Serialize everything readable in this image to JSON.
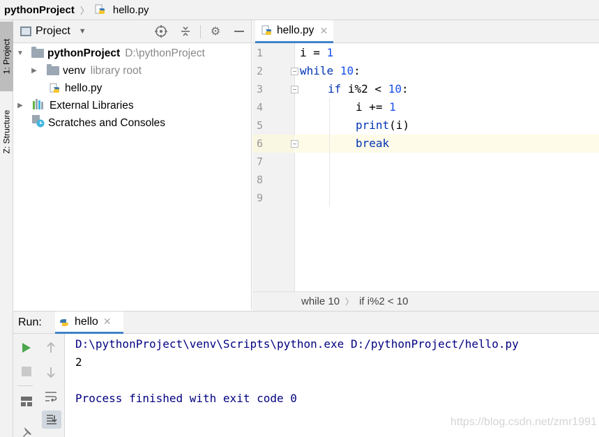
{
  "breadcrumb": {
    "project": "pythonProject",
    "file": "hello.py"
  },
  "side_tabs": {
    "project": "1: Project",
    "structure": "Z: Structure"
  },
  "project_panel": {
    "title": "Project",
    "tree": [
      {
        "name": "pythonProject",
        "note": "D:\\pythonProject"
      },
      {
        "name": "venv",
        "note": "library root"
      },
      {
        "name": "hello.py"
      },
      {
        "name": "External Libraries"
      },
      {
        "name": "Scratches and Consoles"
      }
    ]
  },
  "editor": {
    "tab": "hello.py",
    "line_numbers": [
      "1",
      "2",
      "3",
      "4",
      "5",
      "6",
      "7",
      "8",
      "9"
    ],
    "code": {
      "l1_var": "i",
      "l1_op": " = ",
      "l1_num": "1",
      "l2_kw": "while",
      "l2_num": "10",
      "l2_colon": ":",
      "l3_kw": "if",
      "l3_expr": " i%2 < ",
      "l3_num": "10",
      "l3_colon": ":",
      "l4_expr": "i += ",
      "l4_num": "1",
      "l5_fn": "print",
      "l5_args": "(i)",
      "l6_kw": "break"
    },
    "breadcrumb": [
      "while 10",
      "if i%2 < 10"
    ]
  },
  "run": {
    "label": "Run:",
    "tab": "hello",
    "output": [
      "D:\\pythonProject\\venv\\Scripts\\python.exe D:/pythonProject/hello.py",
      "2",
      "",
      "Process finished with exit code 0"
    ]
  },
  "watermark": "https://blog.csdn.net/zmr1991",
  "colors": {
    "keyword": "#0033b3",
    "number": "#1750eb",
    "console_text": "#000080",
    "accent": "#4083c9",
    "run_green": "#4ca64c"
  }
}
